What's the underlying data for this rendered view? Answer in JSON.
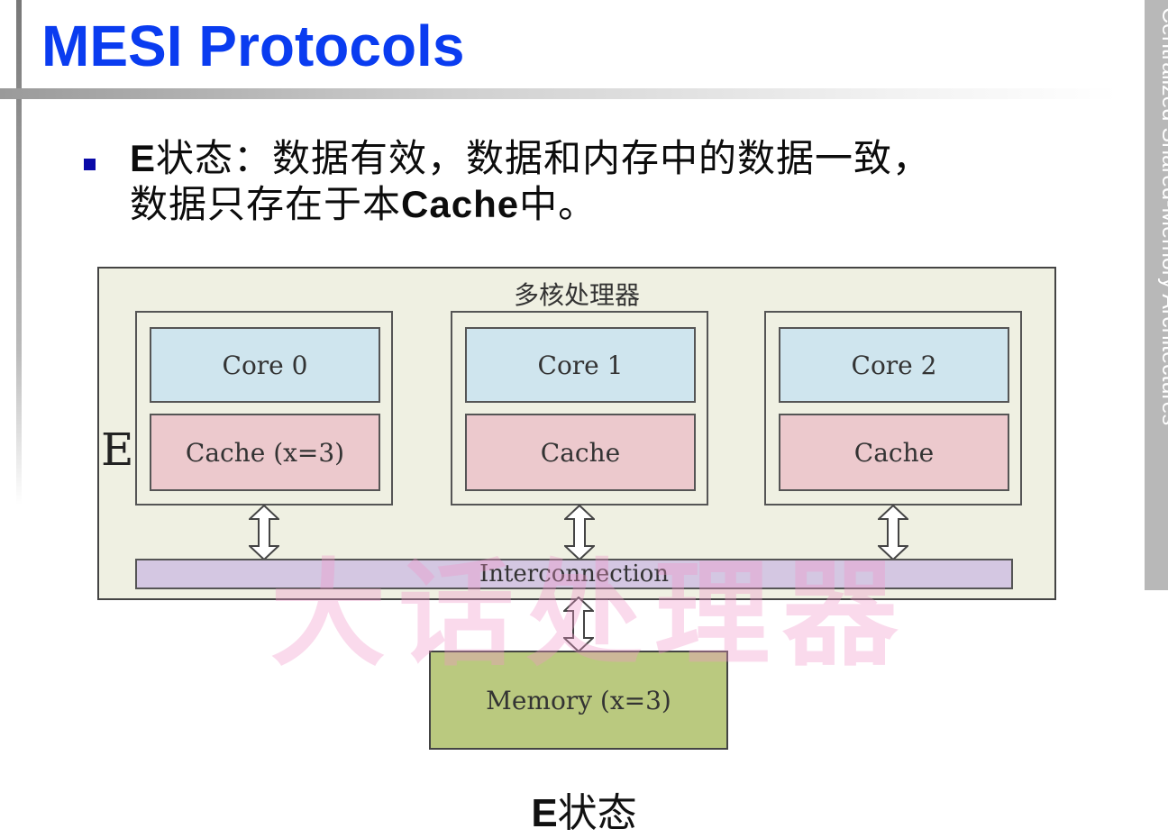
{
  "slide": {
    "title": "MESI Protocols",
    "side_label": "Centralized Shared-Memory Architectures"
  },
  "bullet": {
    "lead": "E",
    "text_line1": "状态：数据有效，数据和内存中的数据一致，",
    "text_line2_a": "数据只存在于本",
    "text_line2_bold": "Cache",
    "text_line2_b": "中。"
  },
  "diagram": {
    "processor_label": "多核处理器",
    "state_marker": "E",
    "cores": [
      {
        "core": "Core 0",
        "cache": "Cache (x=3)"
      },
      {
        "core": "Core 1",
        "cache": "Cache"
      },
      {
        "core": "Core 2",
        "cache": "Cache"
      }
    ],
    "interconnect_label": "Interconnection",
    "memory_label": "Memory (x=3)",
    "watermark": "大话处理器"
  },
  "caption": {
    "lead": "E",
    "text": "状态"
  }
}
